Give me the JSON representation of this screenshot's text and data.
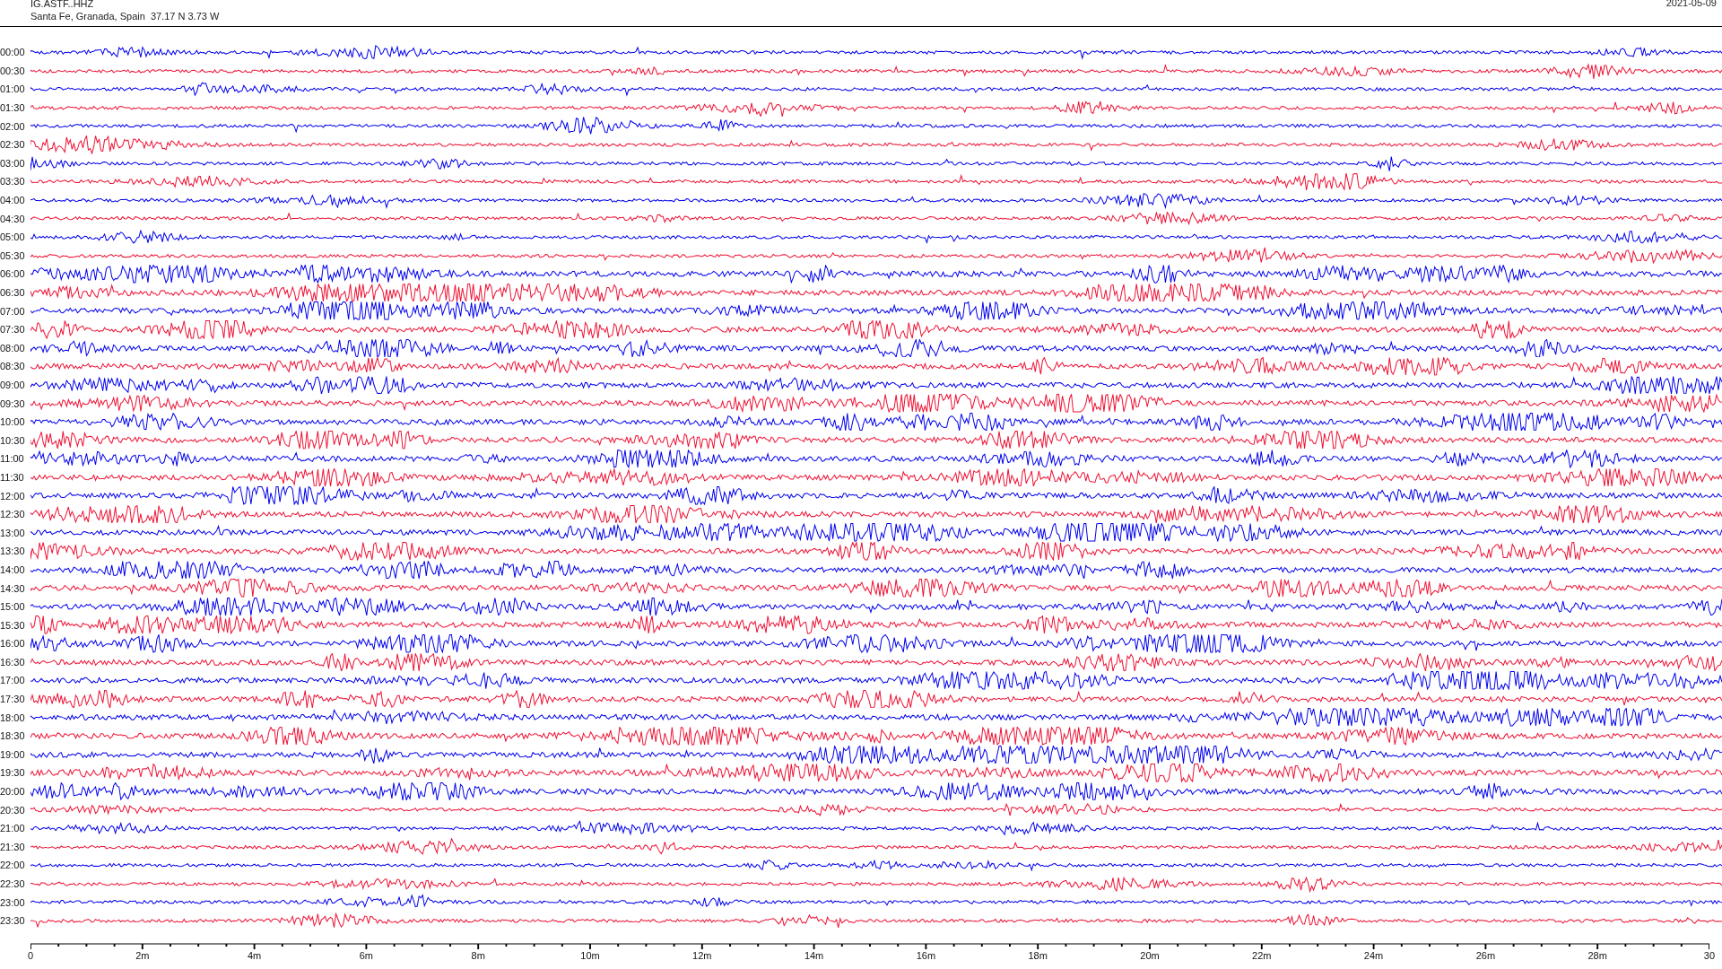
{
  "header": {
    "station": "IG.ASTF..HHZ",
    "location": "Santa Fe, Granada, Spain  37.17 N 3.73 W",
    "date": "2021-05-09"
  },
  "rows": [
    {
      "label": "00:00",
      "color": "#0000ee"
    },
    {
      "label": "00:30",
      "color": "#ee1133"
    },
    {
      "label": "01:00",
      "color": "#0000ee"
    },
    {
      "label": "01:30",
      "color": "#ee1133"
    },
    {
      "label": "02:00",
      "color": "#0000ee"
    },
    {
      "label": "02:30",
      "color": "#ee1133"
    },
    {
      "label": "03:00",
      "color": "#0000ee"
    },
    {
      "label": "03:30",
      "color": "#ee1133"
    },
    {
      "label": "04:00",
      "color": "#0000ee"
    },
    {
      "label": "04:30",
      "color": "#ee1133"
    },
    {
      "label": "05:00",
      "color": "#0000ee"
    },
    {
      "label": "05:30",
      "color": "#ee1133"
    },
    {
      "label": "06:00",
      "color": "#0000ee"
    },
    {
      "label": "06:30",
      "color": "#ee1133"
    },
    {
      "label": "07:00",
      "color": "#0000ee"
    },
    {
      "label": "07:30",
      "color": "#ee1133"
    },
    {
      "label": "08:00",
      "color": "#0000ee"
    },
    {
      "label": "08:30",
      "color": "#ee1133"
    },
    {
      "label": "09:00",
      "color": "#0000ee"
    },
    {
      "label": "09:30",
      "color": "#ee1133"
    },
    {
      "label": "10:00",
      "color": "#0000ee"
    },
    {
      "label": "10:30",
      "color": "#ee1133"
    },
    {
      "label": "11:00",
      "color": "#0000ee"
    },
    {
      "label": "11:30",
      "color": "#ee1133"
    },
    {
      "label": "12:00",
      "color": "#0000ee"
    },
    {
      "label": "12:30",
      "color": "#ee1133"
    },
    {
      "label": "13:00",
      "color": "#0000ee"
    },
    {
      "label": "13:30",
      "color": "#ee1133"
    },
    {
      "label": "14:00",
      "color": "#0000ee"
    },
    {
      "label": "14:30",
      "color": "#ee1133"
    },
    {
      "label": "15:00",
      "color": "#0000ee"
    },
    {
      "label": "15:30",
      "color": "#ee1133"
    },
    {
      "label": "16:00",
      "color": "#0000ee"
    },
    {
      "label": "16:30",
      "color": "#ee1133"
    },
    {
      "label": "17:00",
      "color": "#0000ee"
    },
    {
      "label": "17:30",
      "color": "#ee1133"
    },
    {
      "label": "18:00",
      "color": "#0000ee"
    },
    {
      "label": "18:30",
      "color": "#ee1133"
    },
    {
      "label": "19:00",
      "color": "#0000ee"
    },
    {
      "label": "19:30",
      "color": "#ee1133"
    },
    {
      "label": "20:00",
      "color": "#0000ee"
    },
    {
      "label": "20:30",
      "color": "#ee1133"
    },
    {
      "label": "21:00",
      "color": "#0000ee"
    },
    {
      "label": "21:30",
      "color": "#ee1133"
    },
    {
      "label": "22:00",
      "color": "#0000ee"
    },
    {
      "label": "22:30",
      "color": "#ee1133"
    },
    {
      "label": "23:00",
      "color": "#0000ee"
    },
    {
      "label": "23:30",
      "color": "#ee1133"
    }
  ],
  "axis": {
    "ticks": [
      "0",
      "2m",
      "4m",
      "6m",
      "8m",
      "10m",
      "12m",
      "14m",
      "16m",
      "18m",
      "20m",
      "22m",
      "24m",
      "26m",
      "28m",
      "30"
    ]
  }
}
